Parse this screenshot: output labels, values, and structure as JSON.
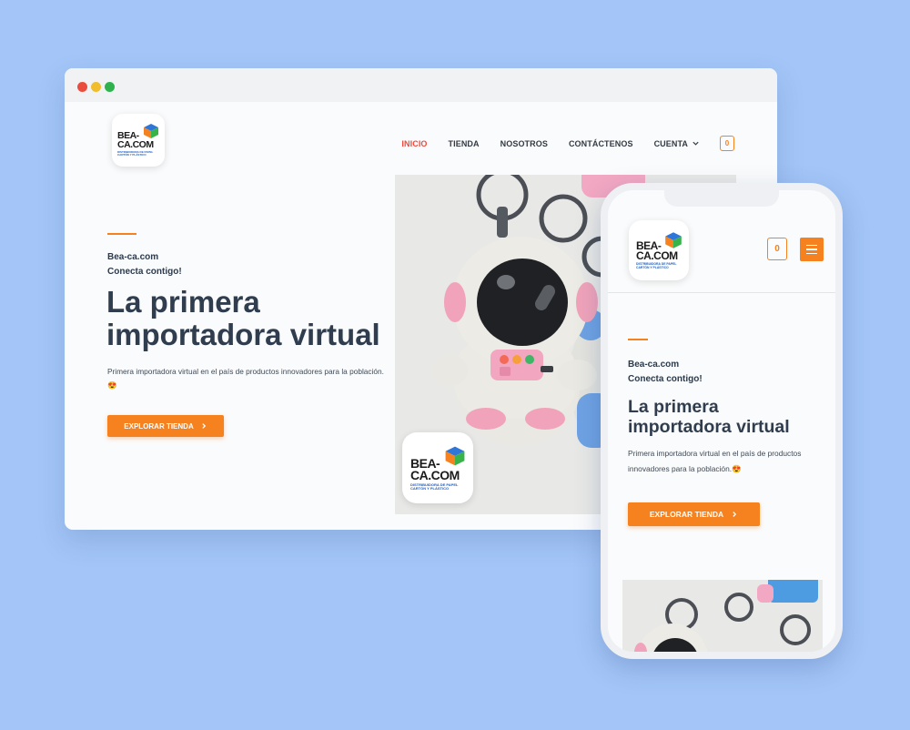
{
  "brand": {
    "logo_line1": "BEA-",
    "logo_line2": "CA.COM",
    "logo_tagline_1": "DISTRIBUIDORA DE PAPEL",
    "logo_tagline_2": "CARTÓN Y PLÁSTICO"
  },
  "nav": {
    "items": [
      {
        "label": "INICIO",
        "active": true
      },
      {
        "label": "TIENDA",
        "active": false
      },
      {
        "label": "NOSOTROS",
        "active": false
      },
      {
        "label": "CONTÁCTENOS",
        "active": false
      },
      {
        "label": "CUENTA",
        "active": false
      }
    ],
    "cart_count": "0"
  },
  "hero": {
    "site_name": "Bea-ca.com",
    "tagline": "Conecta contigo!",
    "title": "La primera importadora virtual",
    "description": "Primera importadora virtual en el país de productos innovadores para la población.",
    "emoji": "😍",
    "cta_label": "EXPLORAR TIENDA"
  },
  "colors": {
    "accent": "#f5821f",
    "active_nav": "#f0483a",
    "heading": "#2f3d4e",
    "background": "#a3c5f7"
  },
  "icons": [
    "cube-logo-icon",
    "cart-icon",
    "chevron-down-icon",
    "chevron-right-icon",
    "hamburger-icon"
  ]
}
